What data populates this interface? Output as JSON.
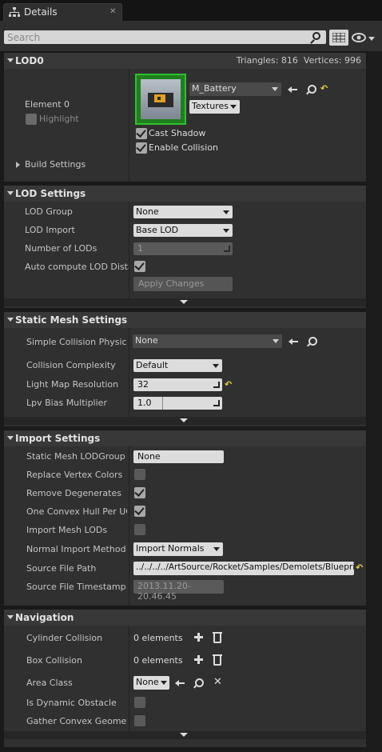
{
  "tab": {
    "title": "Details",
    "close": "✕"
  },
  "search": {
    "placeholder": "Search"
  },
  "lod0": {
    "title": "LOD0",
    "stats": "Triangles: 816  Vertices: 996",
    "element_label": "Element 0",
    "highlight_label": "Highlight",
    "material_name": "M_Battery",
    "textures_label": "Textures",
    "cast_shadow_label": "Cast Shadow",
    "enable_collision_label": "Enable Collision",
    "build_settings_label": "Build Settings",
    "reset_icon": "↶"
  },
  "lod_settings": {
    "title": "LOD Settings",
    "lod_group_label": "LOD Group",
    "lod_group_value": "None",
    "lod_import_label": "LOD Import",
    "lod_import_value": "Base LOD",
    "num_lods_label": "Number of LODs",
    "num_lods_value": "1",
    "auto_compute_label": "Auto compute LOD Distances",
    "apply_changes_label": "Apply Changes"
  },
  "static_mesh": {
    "title": "Static Mesh Settings",
    "simple_collision_label": "Simple Collision Physical Material",
    "simple_collision_value": "None",
    "collision_complexity_label": "Collision Complexity",
    "collision_complexity_value": "Default",
    "light_map_label": "Light Map Resolution",
    "light_map_value": "32",
    "lpv_label": "Lpv Bias Multiplier",
    "lpv_value": "1.0"
  },
  "import_settings": {
    "title": "Import Settings",
    "lodgroup_label": "Static Mesh LODGroup",
    "lodgroup_value": "None",
    "replace_vc_label": "Replace Vertex Colors",
    "remove_degen_label": "Remove Degenerates",
    "convex_hull_label": "One Convex Hull Per UCX",
    "import_lods_label": "Import Mesh LODs",
    "normal_method_label": "Normal Import Method",
    "normal_method_value": "Import Normals",
    "source_path_label": "Source File Path",
    "source_path_value": "../../../../ArtSource/Rocket/Samples/Demolets/Blueprints",
    "source_ts_label": "Source File Timestamp",
    "source_ts_value": "2013.11.20-20.46.45"
  },
  "navigation": {
    "title": "Navigation",
    "cylinder_label": "Cylinder Collision",
    "cylinder_value": "0 elements",
    "box_label": "Box Collision",
    "box_value": "0 elements",
    "area_label": "Area Class",
    "area_value": "None",
    "dynamic_label": "Is Dynamic Obstacle",
    "gather_label": "Gather Convex Geometry"
  },
  "colors": {
    "accent_green": "#2fbf2f",
    "reset_yellow": "#e6d43a",
    "panel": "#303030"
  }
}
